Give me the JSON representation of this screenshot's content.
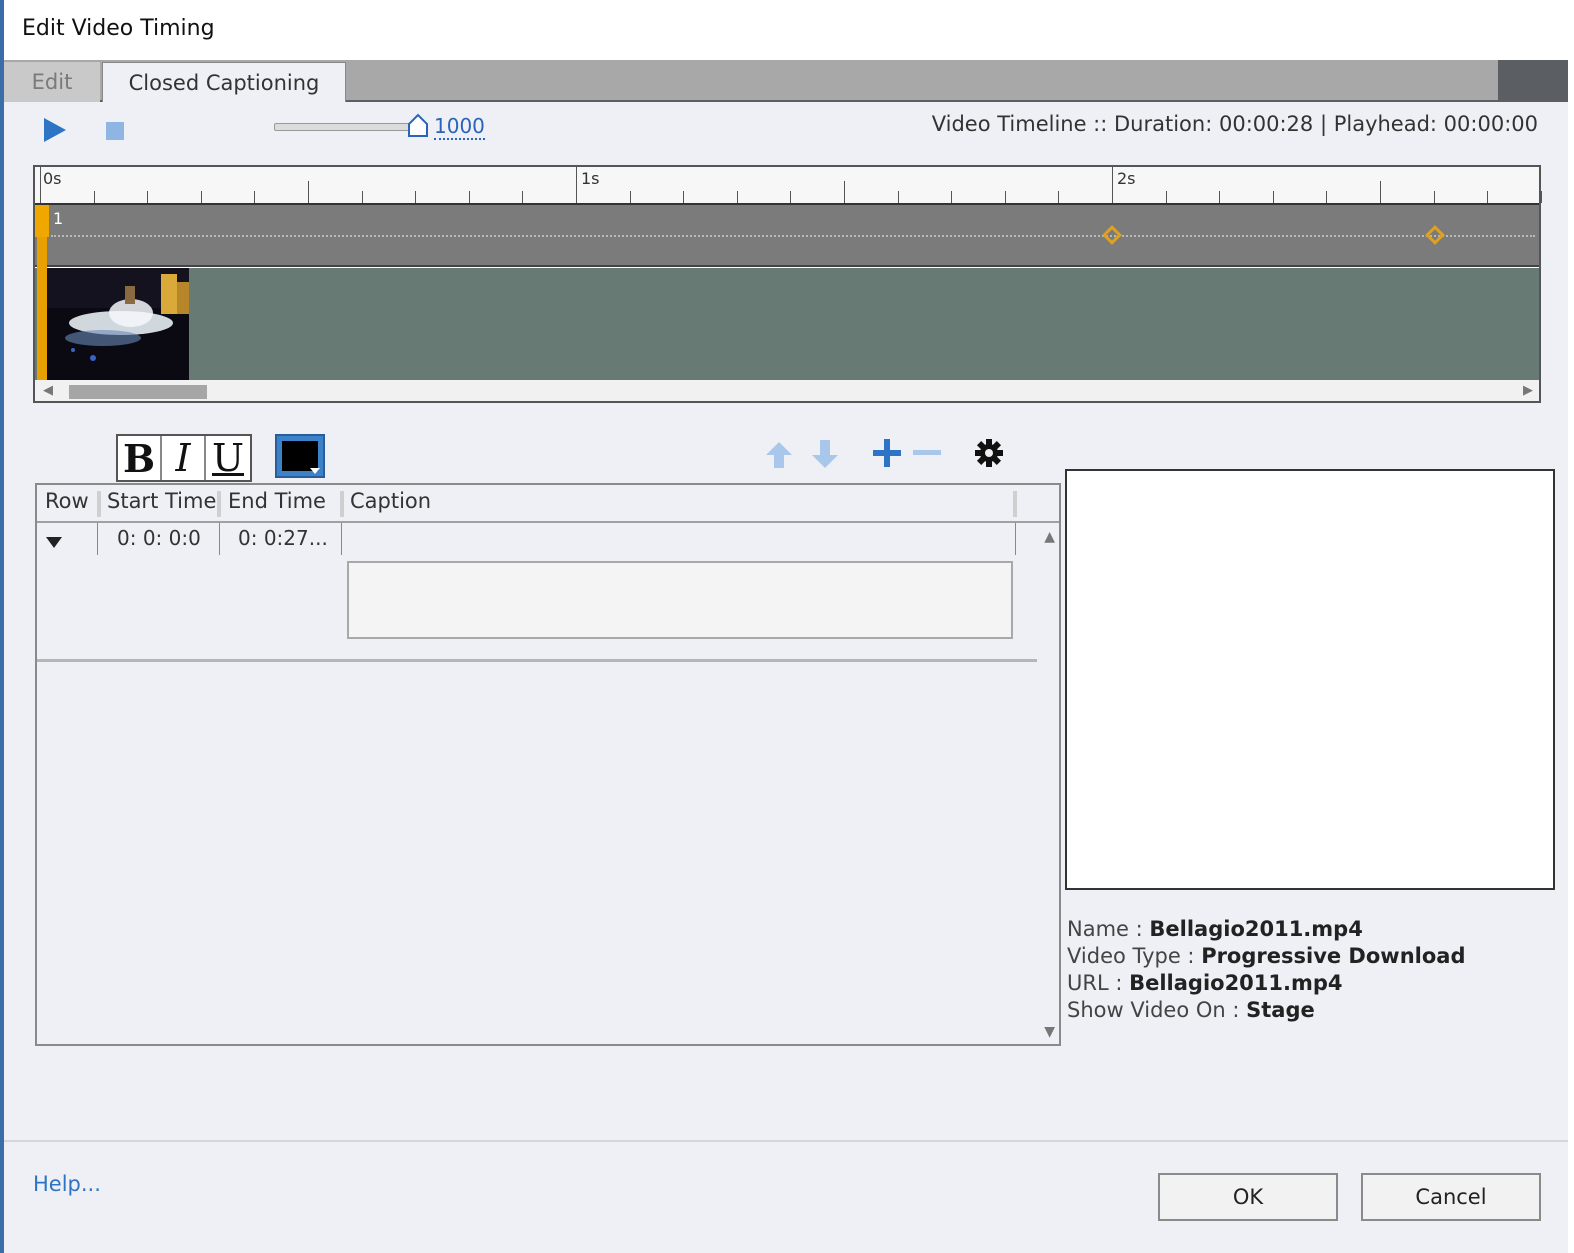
{
  "window": {
    "title": "Edit Video Timing"
  },
  "tabs": [
    {
      "label": "Edit",
      "active": false
    },
    {
      "label": "Closed Captioning",
      "active": true
    }
  ],
  "transport": {
    "play_icon": "play-icon",
    "stop_icon": "stop-icon",
    "zoom_value": "1000"
  },
  "timeline_info": "Video Timeline :: Duration: 00:00:28  |  Playhead: 00:00:00",
  "ruler": {
    "labels": [
      "0s",
      "1s",
      "2s"
    ]
  },
  "caption_track": {
    "number": "1"
  },
  "format": {
    "bold": "B",
    "italic": "I",
    "underline": "U",
    "color": "#000000"
  },
  "grid": {
    "headers": [
      "Row",
      "Start Time",
      "End Time",
      "Caption"
    ],
    "rows": [
      {
        "start": "0: 0: 0:0",
        "end": "0: 0:27...",
        "caption": ""
      }
    ]
  },
  "properties": [
    {
      "label": "Name  : ",
      "value": "Bellagio2011.mp4"
    },
    {
      "label": "Video Type : ",
      "value": "Progressive Download"
    },
    {
      "label": "URL : ",
      "value": "Bellagio2011.mp4"
    },
    {
      "label": "Show Video On : ",
      "value": "Stage"
    }
  ],
  "footer": {
    "help": "Help...",
    "ok": "OK",
    "cancel": "Cancel"
  },
  "colors": {
    "accent": "#2e74c4",
    "keyframe": "#e0a020",
    "playhead": "#e8a000"
  }
}
